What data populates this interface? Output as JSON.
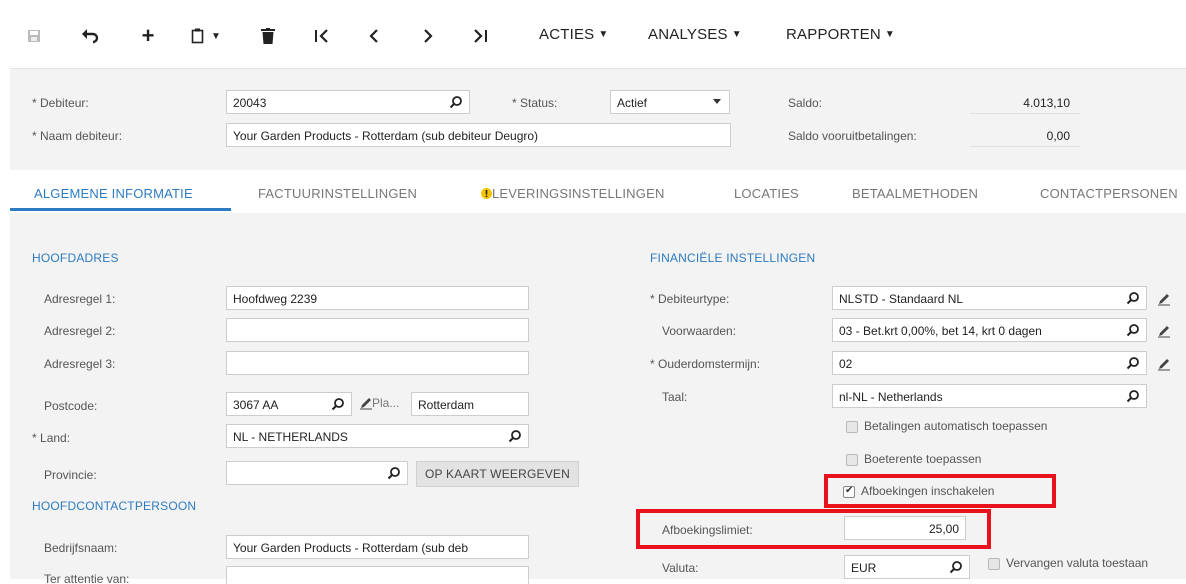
{
  "toolbar": {
    "menus": [
      "ACTIES",
      "ANALYSES",
      "RAPPORTEN"
    ]
  },
  "header": {
    "debiteur_label": "Debiteur:",
    "debiteur_value": "20043",
    "status_label": "Status:",
    "status_value": "Actief",
    "naam_label": "Naam debiteur:",
    "naam_value": "Your Garden Products - Rotterdam (sub debiteur Deugro)",
    "saldo_label": "Saldo:",
    "saldo_value": "4.013,10",
    "saldo_vooruit_label": "Saldo vooruitbetalingen:",
    "saldo_vooruit_value": "0,00"
  },
  "tabs": [
    "ALGEMENE INFORMATIE",
    "FACTUURINSTELLINGEN",
    "LEVERINGSINSTELLINGEN",
    "LOCATIES",
    "BETAALMETHODEN",
    "CONTACTPERSONEN"
  ],
  "hoofdadres": {
    "title": "HOOFDADRES",
    "adres1_label": "Adresregel 1:",
    "adres1_value": "Hoofdweg 2239",
    "adres2_label": "Adresregel 2:",
    "adres2_value": "",
    "adres3_label": "Adresregel 3:",
    "adres3_value": "",
    "postcode_label": "Postcode:",
    "postcode_value": "3067 AA",
    "plaats_label": "Pla...",
    "plaats_value": "Rotterdam",
    "land_label": "Land:",
    "land_value": "NL - NETHERLANDS",
    "provincie_label": "Provincie:",
    "provincie_value": "",
    "map_button": "OP KAART WEERGEVEN"
  },
  "hoofdcontact": {
    "title": "HOOFDCONTACTPERSOON",
    "bedrijf_label": "Bedrijfsnaam:",
    "bedrijf_value": "Your Garden Products - Rotterdam (sub deb",
    "attentie_label": "Ter attentie van:",
    "attentie_value": ""
  },
  "financieel": {
    "title": "FINANCIËLE INSTELLINGEN",
    "debiteurtype_label": "Debiteurtype:",
    "debiteurtype_value": "NLSTD - Standaard NL",
    "voorwaarden_label": "Voorwaarden:",
    "voorwaarden_value": "03 - Bet.krt 0,00%, bet 14, krt 0 dagen",
    "ouderdom_label": "Ouderdomstermijn:",
    "ouderdom_value": "02",
    "taal_label": "Taal:",
    "taal_value": "nl-NL - Netherlands",
    "cb_betalingen": "Betalingen automatisch toepassen",
    "cb_boeterente": "Boeterente toepassen",
    "cb_afboekingen": "Afboekingen inschakelen",
    "afboekingslimiet_label": "Afboekingslimiet:",
    "afboekingslimiet_value": "25,00",
    "valuta_label": "Valuta:",
    "valuta_value": "EUR",
    "cb_vervangen": "Vervangen valuta toestaan"
  },
  "checkbox_states": {
    "betalingen": false,
    "boeterente": false,
    "afboekingen": true,
    "vervangen": false
  },
  "colors": {
    "accent": "#2d7bc0",
    "highlight": "#e8111c",
    "warning": "#f5c400"
  }
}
